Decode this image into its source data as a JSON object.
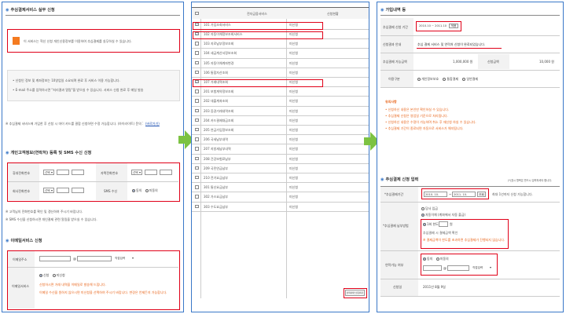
{
  "panel1": {
    "title": "추심결제서비스 실무 신청",
    "notice": "이 서비스는 혁신 신청 개인신용정보를 이용하여 추심결제를 실무하실 수 있습니다.",
    "info_lines": [
      "• 신청인 정보 및 계좌정보는 10영업일 소요되며 완료 후 서비스 이용 가능합니다.",
      "• E-mail 주소를 입력하시면 \"처리결과 알림\"을 받으실 수 있습니다. 서비스 신청 완료 후 메일 발송"
    ],
    "footnote": "※ 추심결제 서비스에 가입한 후 신청 시 마이 카드를 결합 신청하면 수정 가능합니다. (하이라이트) 문의 1577-0000",
    "footnote_link": "(바로가기)",
    "sms_title": "개인고객정보(연락처) 등록 및 SMS 수신 신청",
    "sms": {
      "label_phone": "휴대전화번호",
      "label_home": "자택전화번호",
      "label_office": "회사전화번호",
      "label_sms": "SMS 수신",
      "select_value": "선택",
      "radio_yes": "동의",
      "radio_no": "미동의"
    },
    "sms_notes": [
      "※ 고객님의 전화번호를 확인 및 갱신하여 주시기 바랍니다.",
      "※ SMS 수신을 신청하시면 개인결제 관련 알림을 받으실 수 있습니다."
    ],
    "mail_title": "이메일서비스 신청",
    "mail": {
      "label_email": "이메일주소",
      "label_service": "이메일서비스",
      "at": "@",
      "domain_select": "직접입력",
      "radio_yes": "신청",
      "radio_no": "미신청",
      "orange_1": "신청하시면 거래 내역을 이메일로 발송해 드립니다.",
      "orange_2": "이메일 수신을 원하지 않으시면 미신청을 선택하여 주시기 바랍니다. 변경은 언제든지 가능합니다."
    }
  },
  "panel2": {
    "col_name": "전자금융서비스",
    "col_status": "신청현황",
    "rows": [
      {
        "name": "101 가입조회서비스",
        "status": "미신청",
        "checked": true
      },
      {
        "name": "102 자동이체정보조회서비스",
        "status": "미신청",
        "checked": true
      },
      {
        "name": "103 지로납부정보조회",
        "status": "미신청",
        "checked": false
      },
      {
        "name": "104 세금계산서정보조회",
        "status": "미신청",
        "checked": false
      },
      {
        "name": "105 자동이체계좌변경",
        "status": "미신청",
        "checked": false
      },
      {
        "name": "106 통합자산조회",
        "status": "미신청",
        "checked": false
      },
      {
        "name": "107 거래내역조회",
        "status": "미신청",
        "checked": true
      },
      {
        "name": "201 보험계약정보조회",
        "status": "미신청",
        "checked": false
      },
      {
        "name": "202 대출계좌조회",
        "status": "미신청",
        "checked": false
      },
      {
        "name": "203 증권거래내역조회",
        "status": "미신청",
        "checked": false
      },
      {
        "name": "204 카드결제대금조회",
        "status": "미신청",
        "checked": false
      },
      {
        "name": "205 연금가입정보조회",
        "status": "미신청",
        "checked": false
      },
      {
        "name": "206 국세납부내역",
        "status": "미신청",
        "checked": false
      },
      {
        "name": "207 지방세납부내역",
        "status": "미신청",
        "checked": false
      },
      {
        "name": "208 건강보험료납부",
        "status": "미신청",
        "checked": false
      },
      {
        "name": "209 국민연금납부",
        "status": "미신청",
        "checked": false
      },
      {
        "name": "210 전기요금납부",
        "status": "미신청",
        "checked": false
      },
      {
        "name": "301 통신요금납부",
        "status": "미신청",
        "checked": false
      },
      {
        "name": "302 가스요금납부",
        "status": "미신청",
        "checked": false
      },
      {
        "name": "303 수도요금납부",
        "status": "미신청",
        "checked": false
      }
    ],
    "submit_button": "선택서비스신청하기"
  },
  "panel3": {
    "title": "가입내역 등",
    "rows": [
      {
        "label": "추심결제 신청 기간",
        "value": "2010.10 ~ 2011.10"
      },
      {
        "label": "신청결과 안내",
        "value": "추심 결제 서비스 및 연락처 신청이 완료되었습니다."
      },
      {
        "label": "추심결제 가능금액",
        "value": "1,000,000 원"
      },
      {
        "label": "이용구분",
        "value": "개인"
      }
    ],
    "apply_btn": "적용",
    "amount_label": "신청금액",
    "amount_value": "10,000 원",
    "usage_options": [
      "개인정보보호",
      "통합결제",
      "일반결제"
    ],
    "guide_title": "유의사항",
    "guide_lines": [
      "• 신청하신 내용은 본인만 확인하실 수 있습니다.",
      "• 추심결제 신청은 영업일 기준으로 처리됩니다.",
      "• 신청하신 내용은 수정이 가능하며 취소 후 재신청 하실 수 있습니다.",
      "• 추심결제 기간이 종료되면 자동으로 서비스가 해지됩니다."
    ],
    "apply_title": "추심결제 신청 입력",
    "apply_top_right": "(*)표시 항목은 반드시 입력하셔야 합니다.",
    "period_label": "*추심결제기간",
    "period_from": "2010. 10.",
    "period_to": "2011. 10.",
    "period_btn": "조회",
    "period_note": "최대 1년까지 신청 가능합니다.",
    "method_label": "*추심결제 납부방법",
    "method_opt1": "당사 입금",
    "method_opt2": "자동이체 (계좌에서 자동 출금)",
    "limit_label": "1회 한도",
    "limit_unit": "원",
    "method_note1": "추심결제 시 결제금액 확인",
    "method_note2": "※ 결제금액이 한도를 초과하면 추심결제가 진행되지 않습니다.",
    "contact_label": "연락가능 여부",
    "contact_yes": "동의",
    "contact_no": "미동의",
    "contact_select": "직접입력",
    "date_label": "신청일",
    "date_value": "2011년 8월 9일"
  }
}
